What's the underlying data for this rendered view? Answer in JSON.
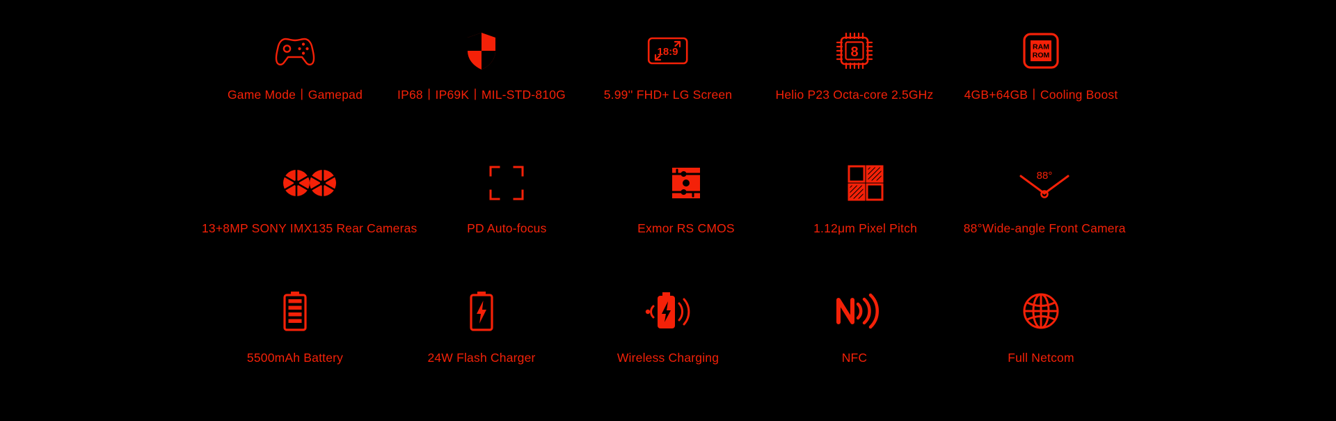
{
  "theme": {
    "background": "#000000",
    "accent": "#f42108",
    "icon_color": "#f42108",
    "icon_knockout": "#000000"
  },
  "rows": [
    {
      "row_id": "performance",
      "cells": [
        {
          "icon": "gamepad-icon",
          "label": "Game Mode丨Gamepad"
        },
        {
          "icon": "shield-icon",
          "label": "IP68丨IP69K丨MIL-STD-810G"
        },
        {
          "icon": "screen-ratio-icon",
          "label": "5.99'' FHD+ LG Screen",
          "icon_text": "18:9"
        },
        {
          "icon": "cpu-chip-icon",
          "label": "Helio P23 Octa-core 2.5GHz",
          "icon_text": "8"
        },
        {
          "icon": "ram-rom-icon",
          "label": "4GB+64GB丨Cooling Boost",
          "icon_text_1": "RAM",
          "icon_text_2": "ROM"
        }
      ]
    },
    {
      "row_id": "camera",
      "cells": [
        {
          "icon": "dual-aperture-icon",
          "label": "13+8MP SONY IMX135 Rear Cameras"
        },
        {
          "icon": "focus-brackets-icon",
          "label": "PD Auto-focus"
        },
        {
          "icon": "cmos-sensor-icon",
          "label": "Exmor RS CMOS"
        },
        {
          "icon": "pixel-grid-icon",
          "label": "1.12μm Pixel Pitch"
        },
        {
          "icon": "wide-angle-icon",
          "label": "88°Wide-angle Front Camera",
          "icon_text": "88°"
        }
      ]
    },
    {
      "row_id": "power-connectivity",
      "cells": [
        {
          "icon": "battery-full-icon",
          "label": "5500mAh Battery"
        },
        {
          "icon": "battery-bolt-icon",
          "label": "24W Flash Charger"
        },
        {
          "icon": "wireless-charging-icon",
          "label": "Wireless Charging"
        },
        {
          "icon": "nfc-icon",
          "label": "NFC"
        },
        {
          "icon": "globe-icon",
          "label": "Full Netcom"
        }
      ]
    }
  ]
}
